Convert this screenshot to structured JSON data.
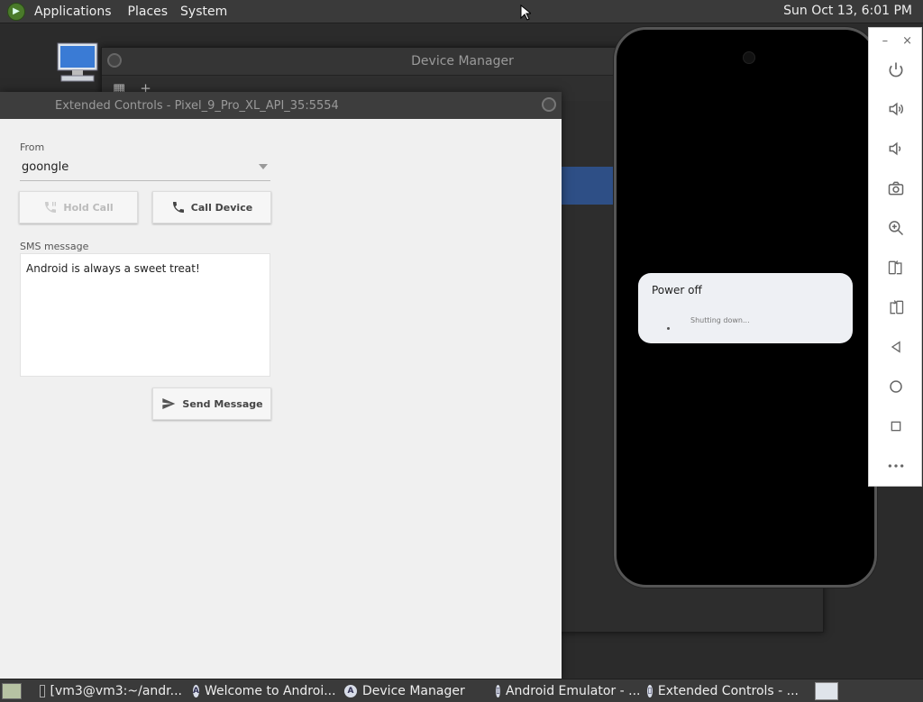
{
  "top_panel": {
    "menus": [
      "Applications",
      "Places",
      "System"
    ],
    "clock": "Sun Oct 13,  6:01 PM"
  },
  "device_manager": {
    "title": "Device Manager"
  },
  "extended_controls": {
    "title": "Extended Controls - Pixel_9_Pro_XL_API_35:5554",
    "from_label": "From",
    "from_value": "goongle",
    "hold_call_label": "Hold Call",
    "call_device_label": "Call Device",
    "sms_label": "SMS message",
    "sms_text": "Android is always a sweet treat!",
    "send_message_label": "Send Message"
  },
  "phone": {
    "dialog_title": "Power off",
    "dialog_status": "Shutting down..."
  },
  "emulator_toolbar": {
    "minimize": "–",
    "close": "×",
    "tools": [
      "power-icon",
      "volume-up-icon",
      "volume-down-icon",
      "camera-icon",
      "zoom-in-icon",
      "rotate-left-icon",
      "rotate-right-icon",
      "back-icon",
      "home-icon",
      "overview-icon",
      "more-icon"
    ]
  },
  "taskbar": {
    "items": [
      {
        "label": "[vm3@vm3:~/andr..."
      },
      {
        "label": "Welcome to Androi..."
      },
      {
        "label": "Device Manager"
      },
      {
        "label": "Android Emulator - ..."
      },
      {
        "label": "Extended Controls - ..."
      }
    ]
  }
}
